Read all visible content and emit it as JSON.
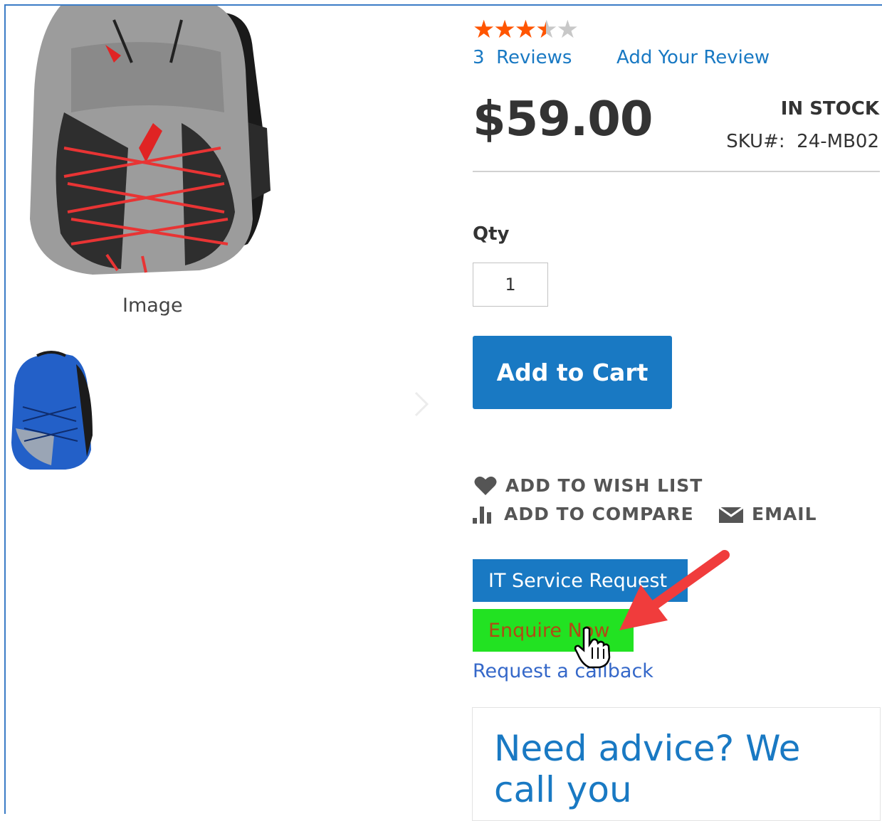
{
  "gallery": {
    "caption": "Image",
    "main_image": "grey-backpack-image",
    "thumbnail": "blue-backpack-thumbnail"
  },
  "rating": {
    "stars_out_of_5": 3.5,
    "star_color": "#ff5501",
    "reviews_count": "3",
    "reviews_label": "Reviews",
    "add_review_label": "Add Your Review"
  },
  "product": {
    "price": "$59.00",
    "stock_status": "IN STOCK",
    "sku_label": "SKU#:",
    "sku": "24-MB02"
  },
  "qty": {
    "label": "Qty",
    "value": "1"
  },
  "buttons": {
    "add_to_cart": "Add to Cart",
    "it_service_request": "IT Service Request",
    "enquire_now": "Enquire Now"
  },
  "actions": {
    "wishlist": "ADD TO WISH LIST",
    "compare": "ADD TO COMPARE",
    "email": "EMAIL"
  },
  "links": {
    "request_callback": "Request a callback"
  },
  "advice": {
    "title": "Need advice? We call you"
  },
  "colors": {
    "primary": "#1979c3",
    "enquire_bg": "#22e222",
    "annotation_arrow": "#f03c3c"
  }
}
